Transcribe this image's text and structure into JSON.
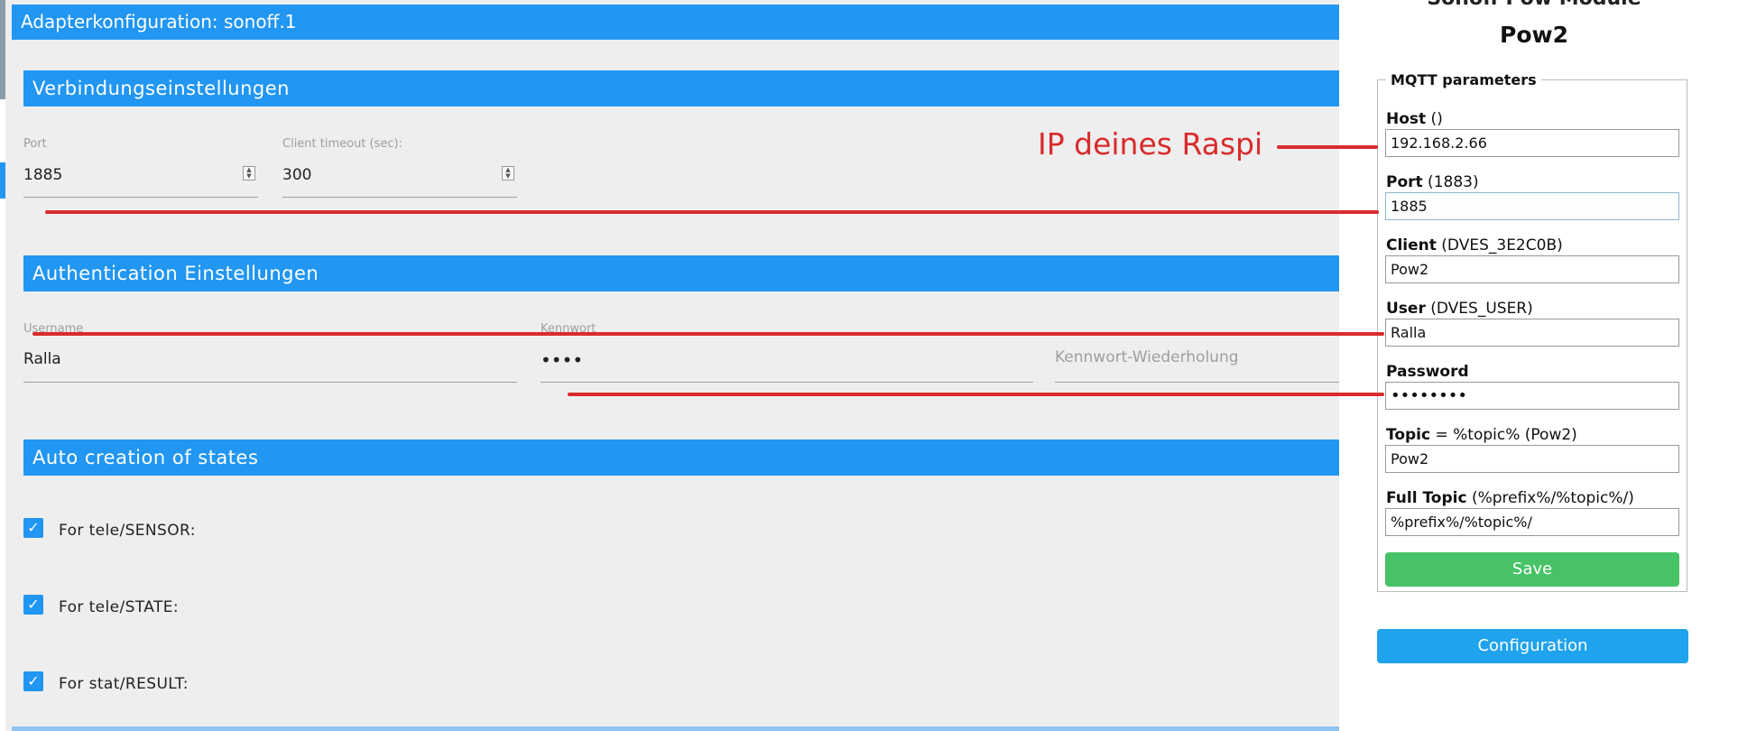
{
  "left": {
    "title": "Adapterkonfiguration: sonoff.1",
    "sections": {
      "connection": "Verbindungseinstellungen",
      "auth": "Authentication Einstellungen",
      "auto": "Auto creation of states"
    },
    "port": {
      "label": "Port",
      "value": "1885"
    },
    "timeout": {
      "label": "Client timeout (sec):",
      "value": "300"
    },
    "username": {
      "label": "Username",
      "value": "Ralla"
    },
    "password": {
      "label": "Kennwort",
      "value": "••••"
    },
    "password_repeat": {
      "placeholder": "Kennwort-Wiederholung"
    },
    "checkboxes": [
      {
        "label": "For tele/SENSOR:",
        "checked": true
      },
      {
        "label": "For tele/STATE:",
        "checked": true
      },
      {
        "label": "For stat/RESULT:",
        "checked": true
      }
    ]
  },
  "right": {
    "title_cut": "Sonoff Pow Module",
    "module": "Pow2",
    "legend": "MQTT parameters",
    "fields": [
      {
        "label_bold": "Host",
        "label_hint": " ()",
        "value": "192.168.2.66"
      },
      {
        "label_bold": "Port",
        "label_hint": " (1883)",
        "value": "1885"
      },
      {
        "label_bold": "Client",
        "label_hint": " (DVES_3E2C0B)",
        "value": "Pow2"
      },
      {
        "label_bold": "User",
        "label_hint": " (DVES_USER)",
        "value": "Ralla"
      },
      {
        "label_bold": "Password",
        "label_hint": "",
        "value": "••••••••"
      },
      {
        "label_bold": "Topic",
        "label_hint": " = %topic% (Pow2)",
        "value": "Pow2"
      },
      {
        "label_bold": "Full Topic",
        "label_hint": " (%prefix%/%topic%/)",
        "value": "%prefix%/%topic%/"
      }
    ],
    "save_label": "Save",
    "config_label": "Configuration"
  },
  "annotation": {
    "text": "IP deines Raspi",
    "color": "#d92b2b"
  },
  "colors": {
    "ioBroker_blue": "#2196f3",
    "tasmota_green": "#47c266",
    "tasmota_blue": "#1fa3ec"
  }
}
